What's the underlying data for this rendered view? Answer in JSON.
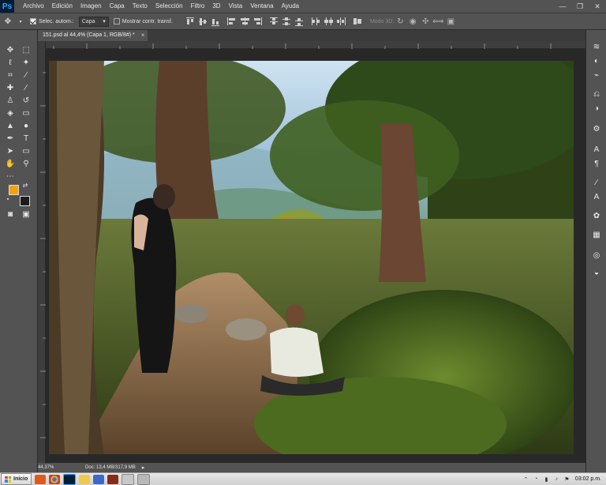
{
  "app": {
    "logo": "Ps",
    "menu": [
      "Archivo",
      "Edición",
      "Imagen",
      "Capa",
      "Texto",
      "Selección",
      "Filtro",
      "3D",
      "Vista",
      "Ventana",
      "Ayuda"
    ],
    "window_controls": {
      "minimize": "—",
      "maximize": "❐",
      "close": "✕"
    }
  },
  "options": {
    "auto_select_label": "Selec. autom.:",
    "auto_select_checked": true,
    "target_value": "Capa",
    "show_transform_label": "Mostrar contr. transf.",
    "show_transform_checked": false,
    "mode3d_label": "Modo 3D:"
  },
  "document": {
    "tab_title": "151.psd al 44,4% (Capa 1, RGB/8#) *",
    "close_icon": "×"
  },
  "status": {
    "zoom": "44,37%",
    "doc_info": "Doc: 13,4 MB/317,9 MB"
  },
  "taskbar": {
    "start_label": "Inicio",
    "clock": "03:02 p.m."
  },
  "colors": {
    "foreground": "#f3a10c",
    "background": "#1c1c1c",
    "ui_panel": "#535353",
    "ps_logo_blue": "#31a8ff"
  },
  "tools": [
    "move-tool",
    "marquee-tool",
    "lasso-tool",
    "magic-wand-tool",
    "crop-tool",
    "eyedropper-tool",
    "healing-brush-tool",
    "brush-tool",
    "clone-stamp-tool",
    "history-brush-tool",
    "eraser-tool",
    "gradient-tool",
    "blur-tool",
    "dodge-tool",
    "pen-tool",
    "type-tool",
    "path-selection-tool",
    "rectangle-tool",
    "hand-tool",
    "zoom-tool"
  ]
}
